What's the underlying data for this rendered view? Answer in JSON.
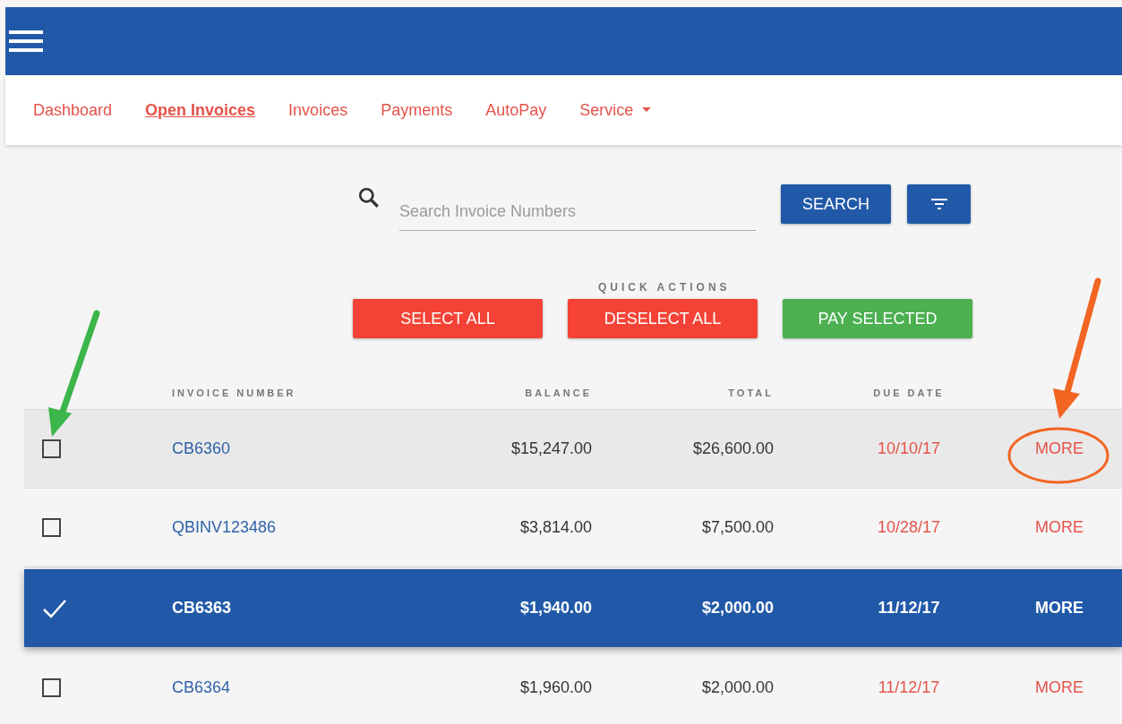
{
  "nav": {
    "items": [
      {
        "label": "Dashboard",
        "selected": false,
        "has_menu": false
      },
      {
        "label": "Open Invoices",
        "selected": true,
        "has_menu": false
      },
      {
        "label": "Invoices",
        "selected": false,
        "has_menu": false
      },
      {
        "label": "Payments",
        "selected": false,
        "has_menu": false
      },
      {
        "label": "AutoPay",
        "selected": false,
        "has_menu": false
      },
      {
        "label": "Service",
        "selected": false,
        "has_menu": true
      }
    ]
  },
  "search": {
    "placeholder": "Search Invoice Numbers",
    "button": "SEARCH"
  },
  "quick_actions": {
    "title": "QUICK ACTIONS",
    "buttons": [
      {
        "label": "SELECT ALL",
        "kind": "danger"
      },
      {
        "label": "DESELECT ALL",
        "kind": "danger"
      },
      {
        "label": "PAY SELECTED",
        "kind": "success"
      }
    ]
  },
  "table": {
    "columns": [
      "INVOICE NUMBER",
      "BALANCE",
      "TOTAL",
      "DUE DATE"
    ],
    "rows": [
      {
        "invoice": "CB6360",
        "balance": "$15,247.00",
        "total": "$26,600.00",
        "due_date": "10/10/17",
        "action": "MORE",
        "selected": false,
        "hovered": true
      },
      {
        "invoice": "QBINV123486",
        "balance": "$3,814.00",
        "total": "$7,500.00",
        "due_date": "10/28/17",
        "action": "MORE",
        "selected": false,
        "hovered": false
      },
      {
        "invoice": "CB6363",
        "balance": "$1,940.00",
        "total": "$2,000.00",
        "due_date": "11/12/17",
        "action": "MORE",
        "selected": true,
        "hovered": false
      },
      {
        "invoice": "CB6364",
        "balance": "$1,960.00",
        "total": "$2,000.00",
        "due_date": "11/12/17",
        "action": "MORE",
        "selected": false,
        "hovered": false
      }
    ]
  }
}
